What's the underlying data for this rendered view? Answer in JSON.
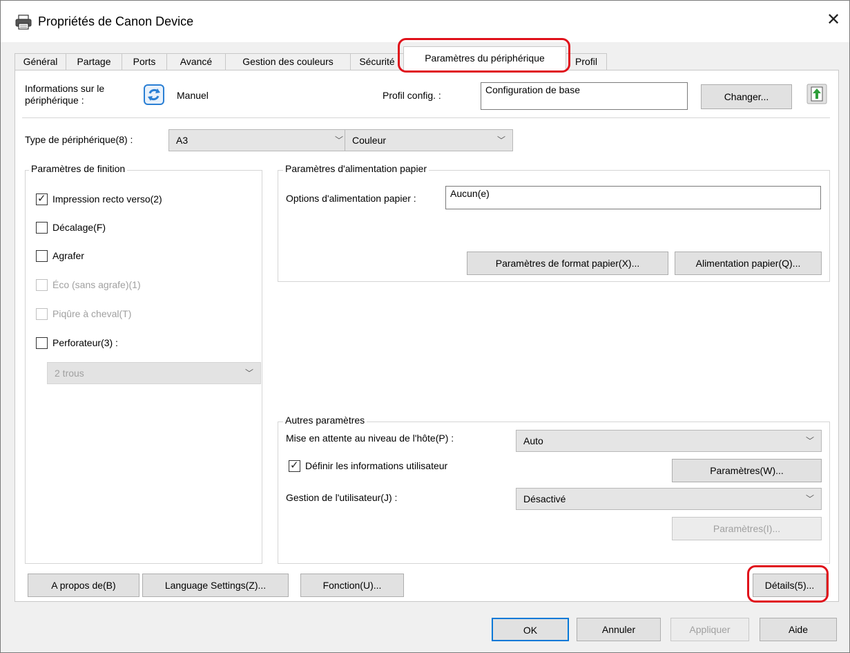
{
  "window": {
    "title": "Propriétés de Canon Device"
  },
  "tabs": [
    {
      "label": "Général"
    },
    {
      "label": "Partage"
    },
    {
      "label": "Ports"
    },
    {
      "label": "Avancé"
    },
    {
      "label": "Gestion des couleurs"
    },
    {
      "label": "Sécurité"
    },
    {
      "label": "Paramètres du périphérique"
    },
    {
      "label": "Profil"
    }
  ],
  "device_info": {
    "label_line1": "Informations sur le",
    "label_line2": "périphérique :",
    "mode": "Manuel",
    "profile_label": "Profil config. :",
    "profile_value": "Configuration de base",
    "change_button": "Changer..."
  },
  "device_type": {
    "label": "Type de périphérique(8) :",
    "size_value": "A3",
    "color_value": "Couleur"
  },
  "finishing": {
    "group_label": "Paramètres de finition",
    "items": [
      {
        "label": "Impression recto verso(2)",
        "checked": true,
        "enabled": true
      },
      {
        "label": "Décalage(F)",
        "checked": false,
        "enabled": true
      },
      {
        "label": "Agrafer",
        "checked": false,
        "enabled": true
      },
      {
        "label": "Éco (sans agrafe)(1)",
        "checked": false,
        "enabled": false
      },
      {
        "label": "Piqûre à cheval(T)",
        "checked": false,
        "enabled": false
      },
      {
        "label": "Perforateur(3) :",
        "checked": false,
        "enabled": true
      }
    ],
    "punch_value": "2 trous"
  },
  "paper_feed": {
    "group_label": "Paramètres d'alimentation papier",
    "options_label": "Options d'alimentation papier :",
    "options_value": "Aucun(e)",
    "format_button": "Paramètres de format papier(X)...",
    "feed_button": "Alimentation papier(Q)..."
  },
  "other": {
    "group_label": "Autres paramètres",
    "hold_label": "Mise en attente au niveau de l'hôte(P) :",
    "hold_value": "Auto",
    "user_info_label": "Définir les informations utilisateur",
    "user_info_checked": true,
    "params_w_button": "Paramètres(W)...",
    "user_mgmt_label": "Gestion de l'utilisateur(J) :",
    "user_mgmt_value": "Désactivé",
    "params_i_button": "Paramètres(I)..."
  },
  "bottom_buttons": {
    "about": "A propos de(B)",
    "language": "Language Settings(Z)...",
    "function": "Fonction(U)...",
    "details": "Détails(5)..."
  },
  "dialog_buttons": {
    "ok": "OK",
    "cancel": "Annuler",
    "apply": "Appliquer",
    "help": "Aide"
  },
  "colors": {
    "highlight": "#e0101a",
    "refresh_icon": "#2a7fd4",
    "upload_icon": "#2e9e3a"
  }
}
